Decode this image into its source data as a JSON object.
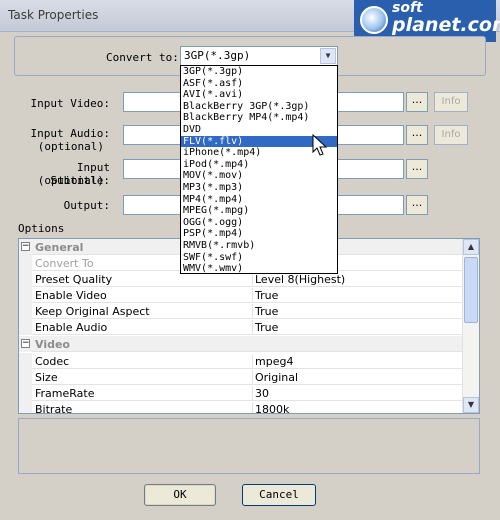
{
  "window": {
    "title": "Task Properties"
  },
  "watermark": {
    "text_top": "soft",
    "text_bottom": "planet.com"
  },
  "convert": {
    "label": "Convert to:",
    "selected": "3GP(*.3gp)",
    "options": [
      "3GP(*.3gp)",
      "ASF(*.asf)",
      "AVI(*.avi)",
      "BlackBerry 3GP(*.3gp)",
      "BlackBerry MP4(*.mp4)",
      "DVD",
      "FLV(*.flv)",
      "iPhone(*.mp4)",
      "iPod(*.mp4)",
      "MOV(*.mov)",
      "MP3(*.mp3)",
      "MP4(*.mp4)",
      "MPEG(*.mpg)",
      "OGG(*.ogg)",
      "PSP(*.mp4)",
      "RMVB(*.rmvb)",
      "SWF(*.swf)",
      "WMV(*.wmv)"
    ],
    "highlighted_index": 6
  },
  "inputs": {
    "video_label": "Input Video:",
    "audio_label_1": "Input Audio:",
    "audio_label_2": "(optional)",
    "subtitle_label_1": "Input Subtitle:",
    "subtitle_label_2": "(optional)",
    "output_label": "Output:",
    "browse": "...",
    "info": "Info"
  },
  "options": {
    "label": "Options",
    "general_header": "General",
    "video_header": "Video",
    "rows": [
      {
        "name": "Convert To",
        "value": ""
      },
      {
        "name": "Preset Quality",
        "value": "Level 8(Highest)"
      },
      {
        "name": "Enable Video",
        "value": "True"
      },
      {
        "name": "Keep Original Aspect",
        "value": "True"
      },
      {
        "name": "Enable Audio",
        "value": "True"
      },
      {
        "name": "Codec",
        "value": "mpeg4"
      },
      {
        "name": "Size",
        "value": "Original"
      },
      {
        "name": "FrameRate",
        "value": "30"
      },
      {
        "name": "Bitrate",
        "value": "1800k"
      }
    ]
  },
  "buttons": {
    "ok": "OK",
    "cancel": "Cancel"
  },
  "icons": {
    "expand": "minus-box-icon",
    "dropdown": "chevron-down-icon",
    "cursor": "arrow-cursor-icon"
  }
}
